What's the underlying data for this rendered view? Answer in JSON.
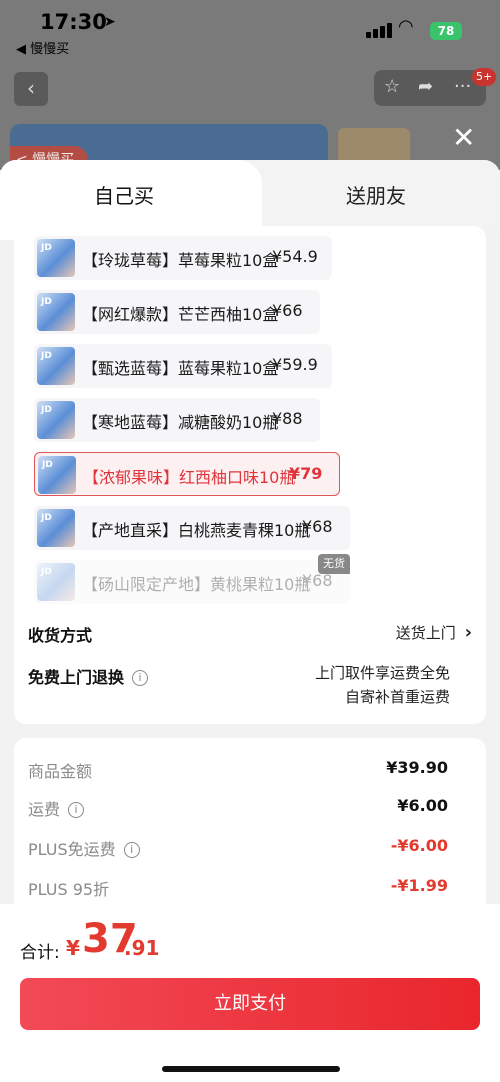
{
  "status_bar": {
    "time": "17:30",
    "back_app": "◀ 慢慢买",
    "battery": "78"
  },
  "nav": {
    "badge": "5+"
  },
  "background": {
    "banner_tag": "< 慢慢买"
  },
  "tabs": [
    {
      "label": "自己买",
      "active": true
    },
    {
      "label": "送朋友",
      "active": false
    }
  ],
  "sku_list": [
    {
      "name": "【玲珑草莓】草莓果粒10盒",
      "price": "¥54.9",
      "state": "normal"
    },
    {
      "name": "【网红爆款】芒芒西柚10盒",
      "price": "¥66",
      "state": "normal"
    },
    {
      "name": "【甄选蓝莓】蓝莓果粒10盒",
      "price": "¥59.9",
      "state": "normal"
    },
    {
      "name": "【寒地蓝莓】减糖酸奶10瓶",
      "price": "¥88",
      "state": "normal"
    },
    {
      "name": "【浓郁果味】红西柚口味10瓶",
      "price": "¥79",
      "state": "selected"
    },
    {
      "name": "【产地直采】白桃燕麦青稞10瓶",
      "price": "¥68",
      "state": "normal"
    },
    {
      "name": "【砀山限定产地】黄桃果粒10瓶",
      "price": "¥68",
      "state": "disabled"
    }
  ],
  "sold_out_tag": "无货",
  "delivery": {
    "label": "收货方式",
    "value": "送货上门"
  },
  "free_return": {
    "label": "免费上门退换",
    "line1": "上门取件享运费全免",
    "line2": "自寄补首重运费"
  },
  "fees": [
    {
      "label": "商品金额",
      "value": "¥39.90",
      "info": false,
      "highlight": false
    },
    {
      "label": "运费",
      "value": "¥6.00",
      "info": true,
      "highlight": false
    },
    {
      "label": "PLUS免运费",
      "value": "-¥6.00",
      "info": true,
      "highlight": true
    },
    {
      "label": "PLUS 95折",
      "value": "-¥1.99",
      "info": false,
      "highlight": true
    }
  ],
  "total": {
    "label": "合计:",
    "currency": "¥",
    "integer": "37",
    "decimal": ".91"
  },
  "pay_button": "立即支付",
  "colors": {
    "accent_red": "#e23a2f",
    "selected_bg": "#fdf0f0",
    "battery_green": "#39c36b"
  }
}
